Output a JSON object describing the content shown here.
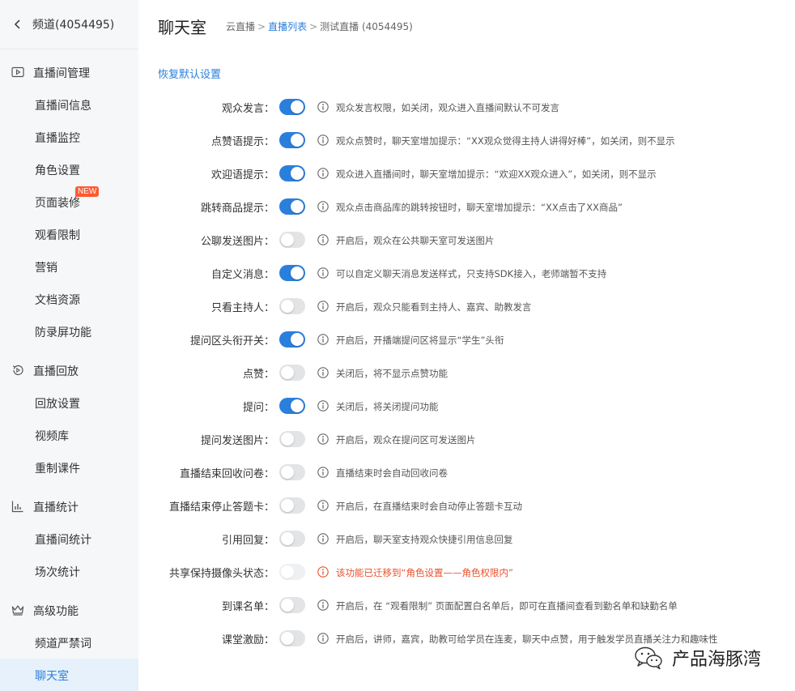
{
  "sidebar": {
    "back_title": "频道(4054495)",
    "groups": [
      {
        "label": "直播间管理",
        "icon": "play-screen-icon"
      },
      {
        "label": "直播回放",
        "icon": "replay-icon"
      },
      {
        "label": "直播统计",
        "icon": "bar-chart-icon"
      },
      {
        "label": "高级功能",
        "icon": "crown-icon"
      }
    ],
    "items": [
      {
        "label": "直播间信息"
      },
      {
        "label": "直播监控"
      },
      {
        "label": "角色设置"
      },
      {
        "label": "页面装修",
        "badge": "NEW"
      },
      {
        "label": "观看限制"
      },
      {
        "label": "营销"
      },
      {
        "label": "文档资源"
      },
      {
        "label": "防录屏功能"
      },
      {
        "label": "回放设置"
      },
      {
        "label": "视频库"
      },
      {
        "label": "重制课件"
      },
      {
        "label": "直播间统计"
      },
      {
        "label": "场次统计"
      },
      {
        "label": "频道严禁词"
      },
      {
        "label": "聊天室",
        "active": true
      }
    ]
  },
  "header": {
    "title": "聊天室",
    "breadcrumb": [
      "云直播",
      "直播列表",
      "测试直播 (4054495)"
    ],
    "separator": ">"
  },
  "restore_default": "恢复默认设置",
  "settings": [
    {
      "label": "观众发言：",
      "state": "on",
      "desc": "观众发言权限，如关闭，观众进入直播间默认不可发言"
    },
    {
      "label": "点赞语提示：",
      "state": "on",
      "desc": "观众点赞时，聊天室增加提示：“XX观众觉得主持人讲得好棒”，如关闭，则不显示"
    },
    {
      "label": "欢迎语提示：",
      "state": "on",
      "desc": "观众进入直播间时，聊天室增加提示：“欢迎XX观众进入”，如关闭，则不显示"
    },
    {
      "label": "跳转商品提示：",
      "state": "on",
      "desc": "观众点击商品库的跳转按钮时，聊天室增加提示：“XX点击了XX商品”"
    },
    {
      "label": "公聊发送图片：",
      "state": "off",
      "desc": "开启后，观众在公共聊天室可发送图片"
    },
    {
      "label": "自定义消息：",
      "state": "on",
      "desc": "可以自定义聊天消息发送样式，只支持SDK接入，老师端暂不支持"
    },
    {
      "label": "只看主持人：",
      "state": "off",
      "desc": "开启后，观众只能看到主持人、嘉宾、助教发言"
    },
    {
      "label": "提问区头衔开关：",
      "state": "on",
      "desc": "开启后，开播端提问区将显示“学生”头衔"
    },
    {
      "label": "点赞：",
      "state": "off",
      "desc": "关闭后，将不显示点赞功能"
    },
    {
      "label": "提问：",
      "state": "on",
      "desc": "关闭后，将关闭提问功能"
    },
    {
      "label": "提问发送图片：",
      "state": "off",
      "desc": "开启后，观众在提问区可发送图片"
    },
    {
      "label": "直播结束回收问卷：",
      "state": "off",
      "desc": "直播结束时会自动回收问卷"
    },
    {
      "label": "直播结束停止答题卡：",
      "state": "off",
      "desc": "开启后，在直播结束时会自动停止答题卡互动"
    },
    {
      "label": "引用回复：",
      "state": "off",
      "desc": "开启后，聊天室支持观众快捷引用信息回复"
    },
    {
      "label": "共享保持摄像头状态：",
      "state": "disabled",
      "warn": true,
      "desc": "该功能已迁移到“角色设置——角色权限内”"
    },
    {
      "label": "到课名单：",
      "state": "off",
      "desc": "开启后，在 “观看限制” 页面配置白名单后，即可在直播间查看到勤名单和缺勤名单"
    },
    {
      "label": "课堂激励：",
      "state": "off",
      "desc": "开启后，讲师，嘉宾，助教可给学员在连麦，聊天中点赞，用于触发学员直播关注力和趣味性"
    }
  ],
  "watermark": {
    "text": "产品海豚湾",
    "icon": "wechat-icon"
  },
  "colors": {
    "accent": "#2b7fdc",
    "warn": "#e8512c",
    "badge": "#ff5a2e",
    "toggle_off": "#e3e4e6"
  }
}
